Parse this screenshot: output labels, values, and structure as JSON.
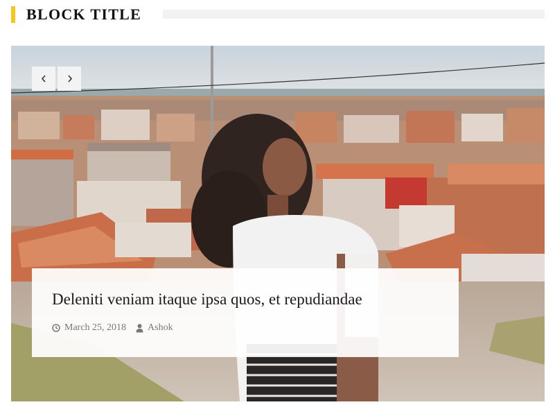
{
  "block": {
    "title": "BLOCK TITLE",
    "accent_color": "#f7c51e"
  },
  "slider": {
    "prev_icon": "chevron-left-icon",
    "next_icon": "chevron-right-icon"
  },
  "post": {
    "title": "Deleniti veniam itaque ipsa quos, et repudiandae",
    "date": "March 25, 2018",
    "author": "Ashok",
    "date_icon": "clock-icon",
    "author_icon": "user-icon"
  }
}
